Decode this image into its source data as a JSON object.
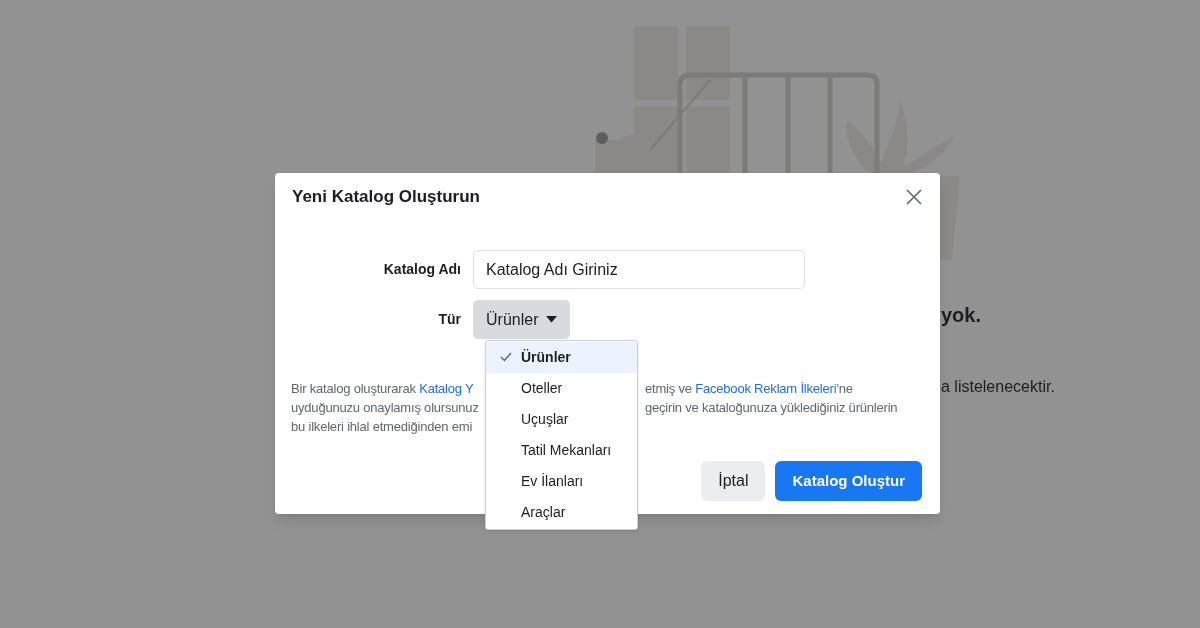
{
  "background": {
    "heading_fragment": "yok.",
    "text_fragment": "a listelenecektir."
  },
  "dialog": {
    "title": "Yeni Katalog Oluşturun",
    "fields": [
      {
        "label": "Katalog Adı",
        "kind": "text",
        "value": "Katalog Adı Giriniz"
      },
      {
        "label": "Tür",
        "kind": "select",
        "value": "Ürünler",
        "expanded": true
      }
    ],
    "dropdown": {
      "options": [
        {
          "label": "Ürünler",
          "selected": true
        },
        {
          "label": "Oteller",
          "selected": false
        },
        {
          "label": "Uçuşlar",
          "selected": false
        },
        {
          "label": "Tatil Mekanları",
          "selected": false
        },
        {
          "label": "Ev İlanları",
          "selected": false
        },
        {
          "label": "Araçlar",
          "selected": false
        }
      ]
    },
    "notice_lines": [
      {
        "left": [
          {
            "text": "Bir katalog oluşturarak ",
            "link": false
          },
          {
            "text": "Katalog Y",
            "link": true
          }
        ],
        "right": [
          {
            "text": "etmiş ve ",
            "link": false
          },
          {
            "text": "Facebook Reklam İlkeleri",
            "link": true
          },
          {
            "text": "'ne",
            "link": false
          }
        ]
      },
      {
        "left": [
          {
            "text": "uyduğunuzu onaylamış olursunuz",
            "link": false
          }
        ],
        "right": [
          {
            "text": "geçirin ve kataloğunuza yüklediğiniz ürünlerin",
            "link": false
          }
        ]
      },
      {
        "left": [
          {
            "text": "bu ilkeleri ihlal etmediğinden emi",
            "link": false
          }
        ]
      }
    ],
    "buttons": [
      {
        "label": "İptal",
        "kind": "secondary"
      },
      {
        "label": "Katalog Oluştur",
        "kind": "primary"
      }
    ]
  }
}
